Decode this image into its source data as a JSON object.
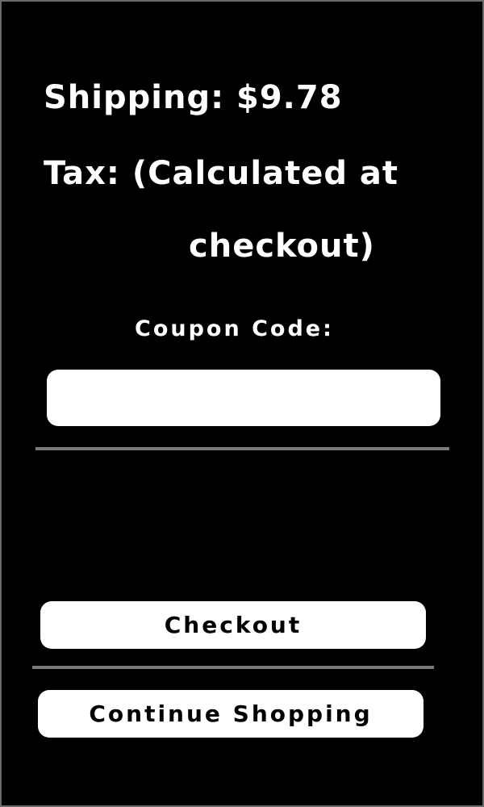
{
  "summary": {
    "shipping": "Shipping: $9.78",
    "tax_line1": "Tax: (Calculated at",
    "tax_line2": "checkout)"
  },
  "coupon": {
    "label": "Coupon Code:",
    "value": "",
    "placeholder": ""
  },
  "actions": {
    "checkout_label": "Checkout",
    "continue_label": "Continue Shopping"
  },
  "colors": {
    "background": "#000000",
    "text": "#ffffff",
    "button_bg": "#ffffff",
    "button_text": "#000000",
    "divider": "#7a7a7a",
    "frame_border": "#6a6a6a"
  }
}
